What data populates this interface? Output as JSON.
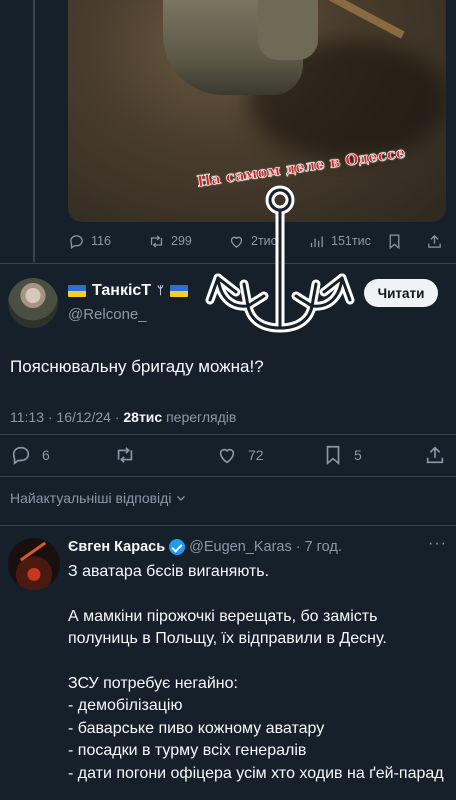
{
  "media": {
    "caption": "На самом деле в Одессе"
  },
  "top_actions": {
    "replies": "116",
    "retweets": "299",
    "likes": "2тис",
    "views": "151тис"
  },
  "tweet": {
    "display_name": "ТанкісТ",
    "handle": "@Relcone_",
    "follow_label": "Читати",
    "text": "Пояснювальну бригаду можна!?",
    "time": "11:13 · 16/12/24 · ",
    "views_count": "28тис",
    "views_label": "переглядів",
    "replies": "6",
    "likes": "72",
    "bookmarks": "5"
  },
  "sort_label": "Найактуальніші відповіді",
  "reply": {
    "name": "Євген Карась",
    "handle": "@Eugen_Karas",
    "time": "· 7 год.",
    "more": "···",
    "lines": [
      "З аватара бєсів виганяють.",
      "",
      "А мамкіни пірожочкі верещать, бо замість полуниць в Польщу, їх відправили в Десну.",
      "",
      "ЗСУ потребує негайно:",
      "- демобілізацію",
      "- баварське пиво кожному аватару",
      "- посадки в турму всіх генералів",
      "- дати погони офіцера усім хто ходив на ґей-парад"
    ]
  },
  "colors": {
    "background": "#15202b",
    "text": "#f7f9f9",
    "muted": "#8b98a5",
    "accent": "#1d9bf0"
  }
}
